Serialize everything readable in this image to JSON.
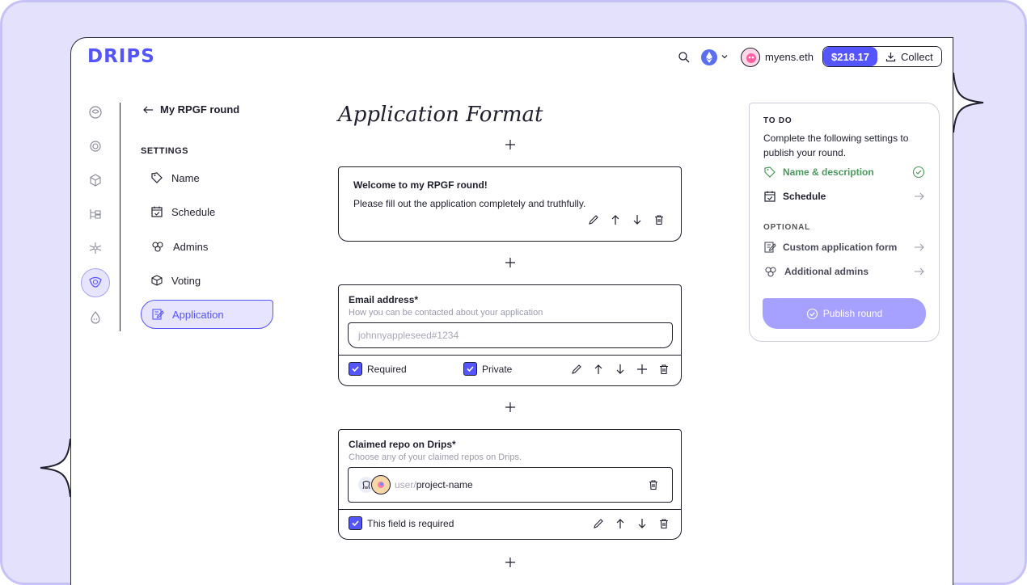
{
  "header": {
    "logo": "DRIPS",
    "ens_name": "myens.eth",
    "balance": "$218.17",
    "collect_label": "Collect"
  },
  "sidebar": {
    "back_label": "My RPGF round",
    "section_label": "SETTINGS",
    "items": [
      {
        "label": "Name",
        "icon": "name-tag-icon"
      },
      {
        "label": "Schedule",
        "icon": "calendar-icon"
      },
      {
        "label": "Admins",
        "icon": "admins-icon"
      },
      {
        "label": "Voting",
        "icon": "ballot-box-icon"
      },
      {
        "label": "Application",
        "icon": "application-form-icon",
        "active": true
      }
    ]
  },
  "main": {
    "title": "Application Format",
    "text_block": {
      "title": "Welcome to my RPGF round!",
      "body": "Please fill out the application completely and truthfully."
    },
    "email_field": {
      "label": "Email address*",
      "hint": "How you can be contacted about your application",
      "placeholder": "johnnyappleseed#1234",
      "required_label": "Required",
      "private_label": "Private",
      "required_checked": true,
      "private_checked": true
    },
    "repo_field": {
      "label": "Claimed repo on Drips*",
      "hint": "Choose any of your claimed repos on Drips.",
      "repo_user": "user",
      "repo_separator": "/",
      "repo_name": "project-name",
      "required_label": "This field is required",
      "required_checked": true
    }
  },
  "todo": {
    "heading": "TO DO",
    "description": "Complete the following settings to publish your round.",
    "items": [
      {
        "label": "Name & description",
        "done": true
      },
      {
        "label": "Schedule",
        "done": false
      }
    ],
    "optional_heading": "OPTIONAL",
    "optional_items": [
      {
        "label": "Custom application form"
      },
      {
        "label": "Additional admins"
      }
    ],
    "publish_label": "Publish round"
  },
  "colors": {
    "accent": "#5555ff",
    "accent_light": "#e6e4ff",
    "success": "#4a9a5c",
    "frame": "#e3e1fb"
  }
}
